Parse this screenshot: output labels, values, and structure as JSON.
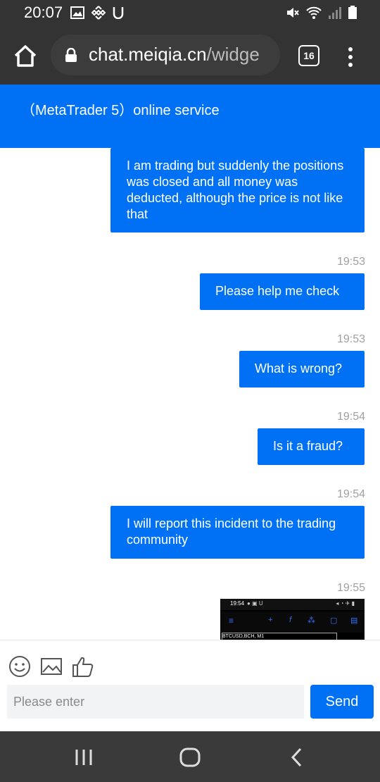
{
  "status_bar": {
    "time": "20:07",
    "left_icons": [
      "image-icon",
      "binance-icon",
      "u-icon"
    ],
    "right_icons": [
      "mute-icon",
      "wifi-icon",
      "signal-icon",
      "battery-icon"
    ]
  },
  "browser": {
    "url_main": "chat.meiqia.cn",
    "url_rest": "/widge",
    "tab_count": "16"
  },
  "chat": {
    "title": "（MetaTrader 5）online service"
  },
  "messages": [
    {
      "text": "I am trading but suddenly the positions was closed and all money was deducted, although the price is not like that",
      "time": ""
    },
    {
      "text": "Please help me check",
      "time": "19:53"
    },
    {
      "text": "What is wrong?",
      "time": "19:53"
    },
    {
      "text": "Is it a fraud?",
      "time": "19:54"
    },
    {
      "text": "I will report this incident to the trading community",
      "time": "19:54"
    }
  ],
  "image_message": {
    "time": "19:55",
    "inner_time": "19:54",
    "inner_label": "BTCUSD,BCH, M1"
  },
  "composer": {
    "placeholder": "Please enter",
    "send_label": "Send"
  },
  "colors": {
    "accent": "#0071f5",
    "bar": "#333333"
  }
}
